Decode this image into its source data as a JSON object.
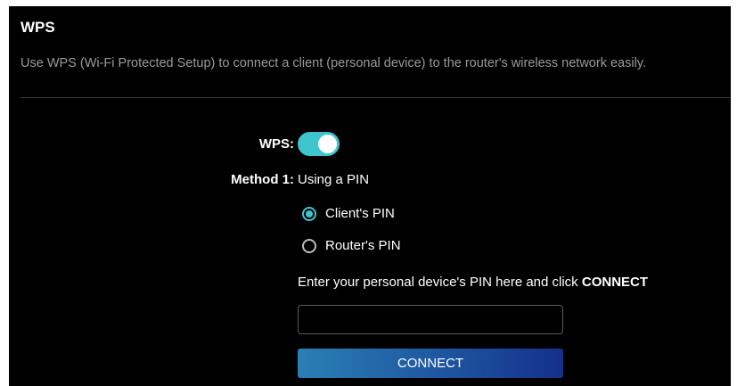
{
  "header": {
    "title": "WPS",
    "description": "Use WPS (Wi-Fi Protected Setup) to connect a client (personal device) to the router's wireless network easily."
  },
  "wps": {
    "label": "WPS:",
    "enabled": true
  },
  "method": {
    "label": "Method 1:",
    "value": "Using a PIN"
  },
  "pin_options": [
    {
      "label": "Client's PIN",
      "selected": true
    },
    {
      "label": "Router's PIN",
      "selected": false
    }
  ],
  "pin_entry": {
    "instruction_prefix": "Enter your personal device's PIN here and click ",
    "instruction_action": "CONNECT",
    "value": "",
    "placeholder": ""
  },
  "connect_button": {
    "label": "CONNECT"
  },
  "colors": {
    "accent": "#3ec6cf",
    "background": "#000000",
    "muted_text": "#9a9a9a",
    "button_gradient_start": "#2a7fb4",
    "button_gradient_end": "#15308a"
  }
}
